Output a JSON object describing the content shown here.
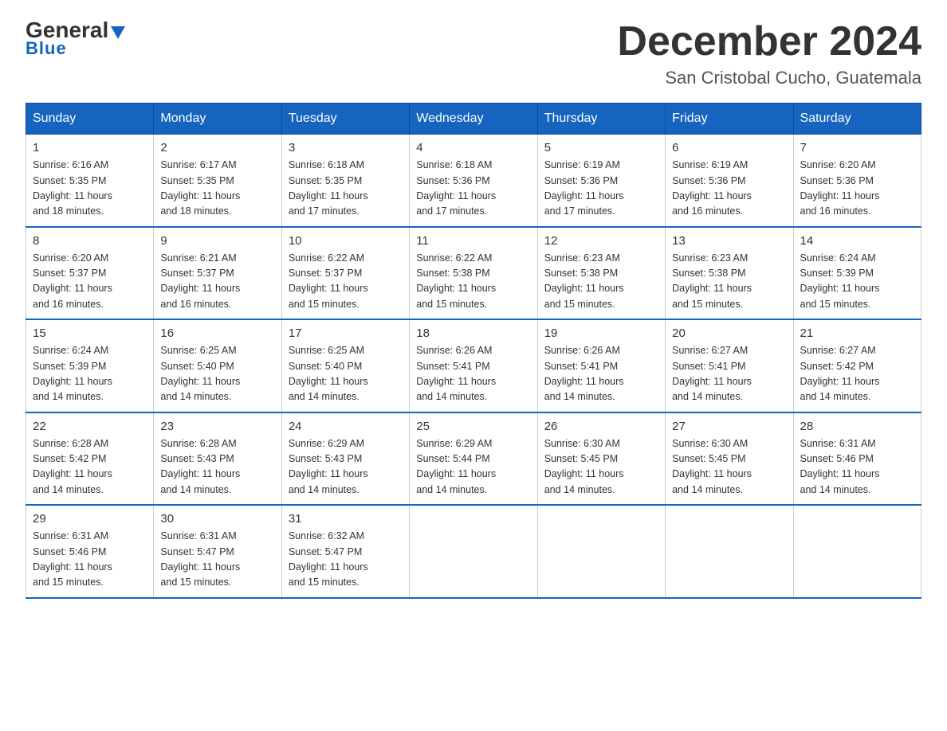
{
  "logo": {
    "general": "General",
    "triangle": "▶",
    "blue": "Blue"
  },
  "header": {
    "month_year": "December 2024",
    "location": "San Cristobal Cucho, Guatemala"
  },
  "weekdays": [
    "Sunday",
    "Monday",
    "Tuesday",
    "Wednesday",
    "Thursday",
    "Friday",
    "Saturday"
  ],
  "weeks": [
    [
      {
        "day": "1",
        "sunrise": "6:16 AM",
        "sunset": "5:35 PM",
        "daylight": "11 hours and 18 minutes."
      },
      {
        "day": "2",
        "sunrise": "6:17 AM",
        "sunset": "5:35 PM",
        "daylight": "11 hours and 18 minutes."
      },
      {
        "day": "3",
        "sunrise": "6:18 AM",
        "sunset": "5:35 PM",
        "daylight": "11 hours and 17 minutes."
      },
      {
        "day": "4",
        "sunrise": "6:18 AM",
        "sunset": "5:36 PM",
        "daylight": "11 hours and 17 minutes."
      },
      {
        "day": "5",
        "sunrise": "6:19 AM",
        "sunset": "5:36 PM",
        "daylight": "11 hours and 17 minutes."
      },
      {
        "day": "6",
        "sunrise": "6:19 AM",
        "sunset": "5:36 PM",
        "daylight": "11 hours and 16 minutes."
      },
      {
        "day": "7",
        "sunrise": "6:20 AM",
        "sunset": "5:36 PM",
        "daylight": "11 hours and 16 minutes."
      }
    ],
    [
      {
        "day": "8",
        "sunrise": "6:20 AM",
        "sunset": "5:37 PM",
        "daylight": "11 hours and 16 minutes."
      },
      {
        "day": "9",
        "sunrise": "6:21 AM",
        "sunset": "5:37 PM",
        "daylight": "11 hours and 16 minutes."
      },
      {
        "day": "10",
        "sunrise": "6:22 AM",
        "sunset": "5:37 PM",
        "daylight": "11 hours and 15 minutes."
      },
      {
        "day": "11",
        "sunrise": "6:22 AM",
        "sunset": "5:38 PM",
        "daylight": "11 hours and 15 minutes."
      },
      {
        "day": "12",
        "sunrise": "6:23 AM",
        "sunset": "5:38 PM",
        "daylight": "11 hours and 15 minutes."
      },
      {
        "day": "13",
        "sunrise": "6:23 AM",
        "sunset": "5:38 PM",
        "daylight": "11 hours and 15 minutes."
      },
      {
        "day": "14",
        "sunrise": "6:24 AM",
        "sunset": "5:39 PM",
        "daylight": "11 hours and 15 minutes."
      }
    ],
    [
      {
        "day": "15",
        "sunrise": "6:24 AM",
        "sunset": "5:39 PM",
        "daylight": "11 hours and 14 minutes."
      },
      {
        "day": "16",
        "sunrise": "6:25 AM",
        "sunset": "5:40 PM",
        "daylight": "11 hours and 14 minutes."
      },
      {
        "day": "17",
        "sunrise": "6:25 AM",
        "sunset": "5:40 PM",
        "daylight": "11 hours and 14 minutes."
      },
      {
        "day": "18",
        "sunrise": "6:26 AM",
        "sunset": "5:41 PM",
        "daylight": "11 hours and 14 minutes."
      },
      {
        "day": "19",
        "sunrise": "6:26 AM",
        "sunset": "5:41 PM",
        "daylight": "11 hours and 14 minutes."
      },
      {
        "day": "20",
        "sunrise": "6:27 AM",
        "sunset": "5:41 PM",
        "daylight": "11 hours and 14 minutes."
      },
      {
        "day": "21",
        "sunrise": "6:27 AM",
        "sunset": "5:42 PM",
        "daylight": "11 hours and 14 minutes."
      }
    ],
    [
      {
        "day": "22",
        "sunrise": "6:28 AM",
        "sunset": "5:42 PM",
        "daylight": "11 hours and 14 minutes."
      },
      {
        "day": "23",
        "sunrise": "6:28 AM",
        "sunset": "5:43 PM",
        "daylight": "11 hours and 14 minutes."
      },
      {
        "day": "24",
        "sunrise": "6:29 AM",
        "sunset": "5:43 PM",
        "daylight": "11 hours and 14 minutes."
      },
      {
        "day": "25",
        "sunrise": "6:29 AM",
        "sunset": "5:44 PM",
        "daylight": "11 hours and 14 minutes."
      },
      {
        "day": "26",
        "sunrise": "6:30 AM",
        "sunset": "5:45 PM",
        "daylight": "11 hours and 14 minutes."
      },
      {
        "day": "27",
        "sunrise": "6:30 AM",
        "sunset": "5:45 PM",
        "daylight": "11 hours and 14 minutes."
      },
      {
        "day": "28",
        "sunrise": "6:31 AM",
        "sunset": "5:46 PM",
        "daylight": "11 hours and 14 minutes."
      }
    ],
    [
      {
        "day": "29",
        "sunrise": "6:31 AM",
        "sunset": "5:46 PM",
        "daylight": "11 hours and 15 minutes."
      },
      {
        "day": "30",
        "sunrise": "6:31 AM",
        "sunset": "5:47 PM",
        "daylight": "11 hours and 15 minutes."
      },
      {
        "day": "31",
        "sunrise": "6:32 AM",
        "sunset": "5:47 PM",
        "daylight": "11 hours and 15 minutes."
      },
      null,
      null,
      null,
      null
    ]
  ],
  "labels": {
    "sunrise": "Sunrise:",
    "sunset": "Sunset:",
    "daylight": "Daylight:"
  }
}
